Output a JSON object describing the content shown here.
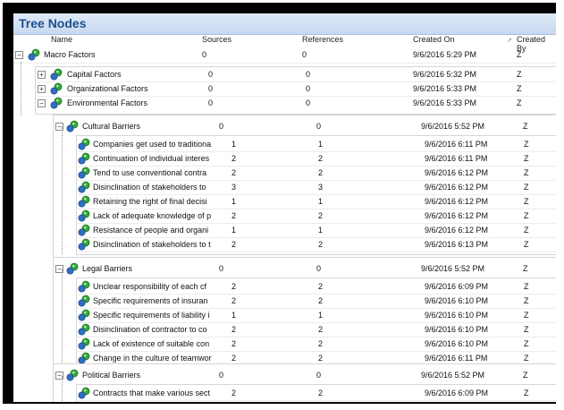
{
  "panel_title": "Tree Nodes",
  "columns": {
    "name": "Name",
    "sources": "Sources",
    "references": "References",
    "created_on": "Created On",
    "created_by": "Created By"
  },
  "root": {
    "name": "Macro Factors",
    "sources": "0",
    "references": "0",
    "created_on": "9/6/2016 5:29 PM",
    "created_by": "Z"
  },
  "factors": [
    {
      "name": "Capital Factors",
      "sources": "0",
      "references": "0",
      "created_on": "9/6/2016 5:32 PM",
      "created_by": "Z"
    },
    {
      "name": "Organizational Factors",
      "sources": "0",
      "references": "0",
      "created_on": "9/6/2016 5:33 PM",
      "created_by": "Z"
    },
    {
      "name": "Environmental Factors",
      "sources": "0",
      "references": "0",
      "created_on": "9/6/2016 5:33 PM",
      "created_by": "Z"
    }
  ],
  "barriers": [
    {
      "name": "Cultural Barriers",
      "sources": "0",
      "references": "0",
      "created_on": "9/6/2016 5:52 PM",
      "created_by": "Z",
      "children": [
        {
          "name": "Companies get used to traditiona",
          "sources": "1",
          "references": "1",
          "created_on": "9/6/2016 6:11 PM",
          "created_by": "Z"
        },
        {
          "name": "Continuation of individual interes",
          "sources": "2",
          "references": "2",
          "created_on": "9/6/2016 6:11 PM",
          "created_by": "Z"
        },
        {
          "name": "Tend to use conventional contra",
          "sources": "2",
          "references": "2",
          "created_on": "9/6/2016 6:12 PM",
          "created_by": "Z"
        },
        {
          "name": "Disinclination of stakeholders to",
          "sources": "3",
          "references": "3",
          "created_on": "9/6/2016 6:12 PM",
          "created_by": "Z"
        },
        {
          "name": "Retaining the right of final decisi",
          "sources": "1",
          "references": "1",
          "created_on": "9/6/2016 6:12 PM",
          "created_by": "Z"
        },
        {
          "name": "Lack of adequate knowledge of p",
          "sources": "2",
          "references": "2",
          "created_on": "9/6/2016 6:12 PM",
          "created_by": "Z"
        },
        {
          "name": "Resistance of people and organi",
          "sources": "1",
          "references": "1",
          "created_on": "9/6/2016 6:12 PM",
          "created_by": "Z"
        },
        {
          "name": "Disinclination of stakeholders to t",
          "sources": "2",
          "references": "2",
          "created_on": "9/6/2016 6:13 PM",
          "created_by": "Z"
        }
      ]
    },
    {
      "name": "Legal Barriers",
      "sources": "0",
      "references": "0",
      "created_on": "9/6/2016 5:52 PM",
      "created_by": "Z",
      "children": [
        {
          "name": "Unclear responsibility of each cf",
          "sources": "2",
          "references": "2",
          "created_on": "9/6/2016 6:09 PM",
          "created_by": "Z"
        },
        {
          "name": "Specific requirements of insuran",
          "sources": "2",
          "references": "2",
          "created_on": "9/6/2016 6:10 PM",
          "created_by": "Z"
        },
        {
          "name": "Specific requirements of liability i",
          "sources": "1",
          "references": "1",
          "created_on": "9/6/2016 6:10 PM",
          "created_by": "Z"
        },
        {
          "name": "Disinclination of contractor to co",
          "sources": "2",
          "references": "2",
          "created_on": "9/6/2016 6:10 PM",
          "created_by": "Z"
        },
        {
          "name": "Lack of existence of suitable con",
          "sources": "2",
          "references": "2",
          "created_on": "9/6/2016 6:10 PM",
          "created_by": "Z"
        },
        {
          "name": "Change in the culture of teamwor",
          "sources": "2",
          "references": "2",
          "created_on": "9/6/2016 6:11 PM",
          "created_by": "Z"
        }
      ]
    },
    {
      "name": "Political Barriers",
      "sources": "0",
      "references": "0",
      "created_on": "9/6/2016 5:52 PM",
      "created_by": "Z",
      "children": [
        {
          "name": "Contracts that make various sect",
          "sources": "2",
          "references": "2",
          "created_on": "9/6/2016 6:09 PM",
          "created_by": "Z"
        }
      ]
    }
  ],
  "icons": {
    "node": "node-icon",
    "expand": "plus-icon",
    "collapse": "minus-icon"
  },
  "colors": {
    "title_text": "#1f4e8c",
    "node_green": "#3aa53a",
    "node_blue": "#2f6fbf"
  }
}
